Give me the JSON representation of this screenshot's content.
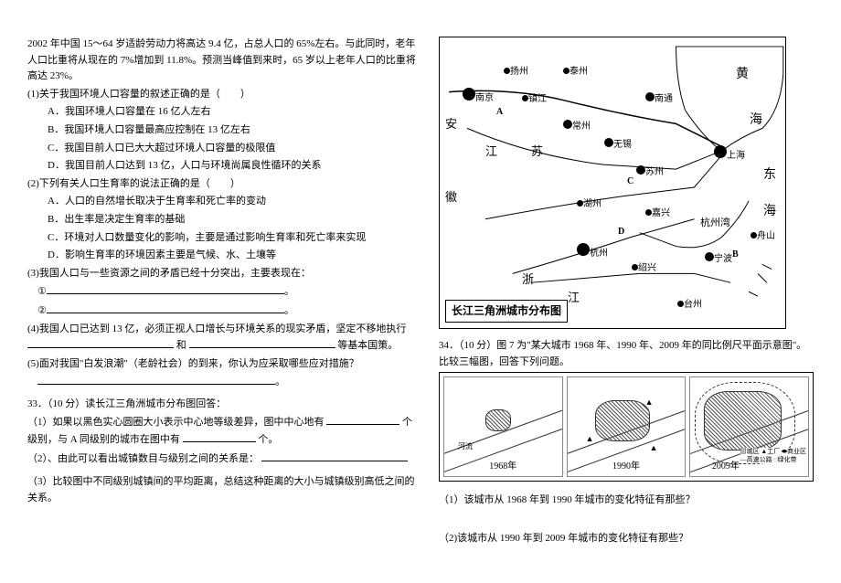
{
  "intro": "2002 年中国 15～64 岁适龄劳动力将高达 9.4 亿，占总人口的 65%左右。与此同时，老年人口比重将从现在的 7%增加到 11.8%。预测当峰值到来时，65 岁以上老年人口的比重将高达 23%。",
  "q1": {
    "stem": "(1)关于我国环境人口容量的叙述正确的是（　　）",
    "a": "A．我国环境人口容量在 16 亿人左右",
    "b": "B．我国环境人口容量最高应控制在 13 亿左右",
    "c": "C．我国目前人口已大大超过环境人口容量的极限值",
    "d": "D．我国目前人口达到 13 亿，人口与环境尚属良性循环的关系"
  },
  "q2": {
    "stem": "(2)下列有关人口生育率的说法正确的是（　　）",
    "a": "A．人口的自然增长取决于生育率和死亡率的变动",
    "b": "B．出生率是决定生育率的基础",
    "c": "C．环境对人口数量变化的影响，主要是通过影响生育率和死亡率来实现",
    "d": "D．影响生育率的环境因素主要是气候、水、土壤等"
  },
  "q3": {
    "stem": "(3)我国人口与一些资源之间的矛盾已经十分突出，主要表现在：",
    "line1": "①",
    "line2": "②"
  },
  "q4": {
    "stem_a": "(4)我国人口已达到 13 亿，必须正视人口增长与环境关系的现实矛盾，坚定不移地执行",
    "stem_b": "和",
    "stem_c": "等基本国策。"
  },
  "q5": {
    "stem": "(5)面对我国\"白发浪潮\"（老龄社会）的到来，你认为应采取哪些应对措施？"
  },
  "q33": {
    "title": "33．（10 分）读长江三角洲城市分布图回答：",
    "p1a": "（1）如果以黑色实心圆圈大小表示中心地等级差异，图中中心地有",
    "p1b": "个级别，与 A 同级别的城市在图中有",
    "p1c": "个。",
    "p2a": "（2）、由此可以看出城镇数目与级别之间的关系是：",
    "p3": "（3）比较图中不同级别城镇间的平均距离，总结这种距离的大小与城镇级别高低之间的关系。"
  },
  "map": {
    "title": "长江三角洲城市分布图",
    "cities": {
      "yangzhou": "扬州",
      "taizhou": "泰州",
      "nanjing": "南京",
      "zhenjiang": "镇江",
      "changzhou": "常州",
      "nantong": "南通",
      "wuxi": "无锡",
      "suzhou": "苏州",
      "shanghai": "上海",
      "huzhou": "湖州",
      "jiaxing": "嘉兴",
      "hangzhou": "杭州",
      "shaoxing": "绍兴",
      "ningbo": "宁波",
      "zhoushan": "舟山",
      "taizhou2": "台州"
    },
    "labels": {
      "huang": "黄",
      "hai": "海",
      "dong": "东",
      "hai2": "海",
      "an": "安",
      "jiang": "江",
      "hui": "徽",
      "su": "苏",
      "zhe": "浙",
      "jiang2": "江",
      "hangzhouwan": "杭州湾",
      "a": "A",
      "b": "B",
      "c": "C",
      "d": "D"
    }
  },
  "q34": {
    "title": "34．（10 分）图 7 为\"某大城市 1968 年、1990 年、2009 年的同比例尺平面示意图\"。比较三幅图，回答下列问题。",
    "years": {
      "y1": "1968年",
      "y2": "1990年",
      "y3": "2009年"
    },
    "legend": {
      "urban": "城区",
      "factory": "工厂",
      "commercial": "商业区",
      "highway": "高速公路",
      "green": "绿化带"
    },
    "river": "河流",
    "p1": "（1）该城市从 1968 年到 1990 年城市的变化特征有那些？",
    "p2": "（2)该城市从 1990 年到 2009 年城市的变化特征有那些？"
  }
}
